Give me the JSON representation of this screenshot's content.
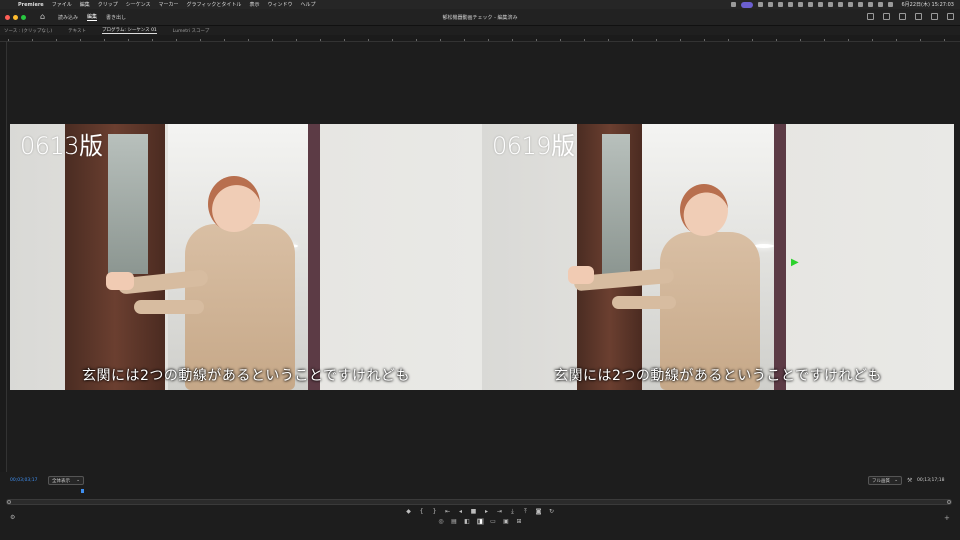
{
  "menubar": {
    "app_name": "Premiere",
    "items": [
      "ファイル",
      "編集",
      "クリップ",
      "シーケンス",
      "マーカー",
      "グラフィックとタイトル",
      "表示",
      "ウィンドウ",
      "ヘルプ"
    ],
    "clock": "6月22日(木) 15:27:03"
  },
  "header": {
    "workspace_tabs": [
      "読み込み",
      "編集",
      "書き出し"
    ],
    "active_tab": "編集",
    "document_title": "郁松機器動画チェック - 編集済み"
  },
  "panel_tabs": [
    "ソース : (クリップなし)",
    "テキスト",
    "プログラム: シーケンス 01",
    "Lumetri スコープ"
  ],
  "active_panel": "プログラム: シーケンス 01",
  "program": {
    "left_label": "0613版",
    "right_label": "0619版",
    "left_subtitle": "玄関には2つの動線があるということですけれども",
    "right_subtitle": "玄関には2つの動線があるということですけれども"
  },
  "controls": {
    "timecode_current": "00;03;03;17",
    "zoom_option": "全体表示",
    "quality_option": "フル画質",
    "timecode_duration": "00;13;17;18"
  },
  "colors": {
    "accent": "#3f8ff0",
    "cursor": "#2bd12b",
    "background": "#1d1d1d"
  }
}
